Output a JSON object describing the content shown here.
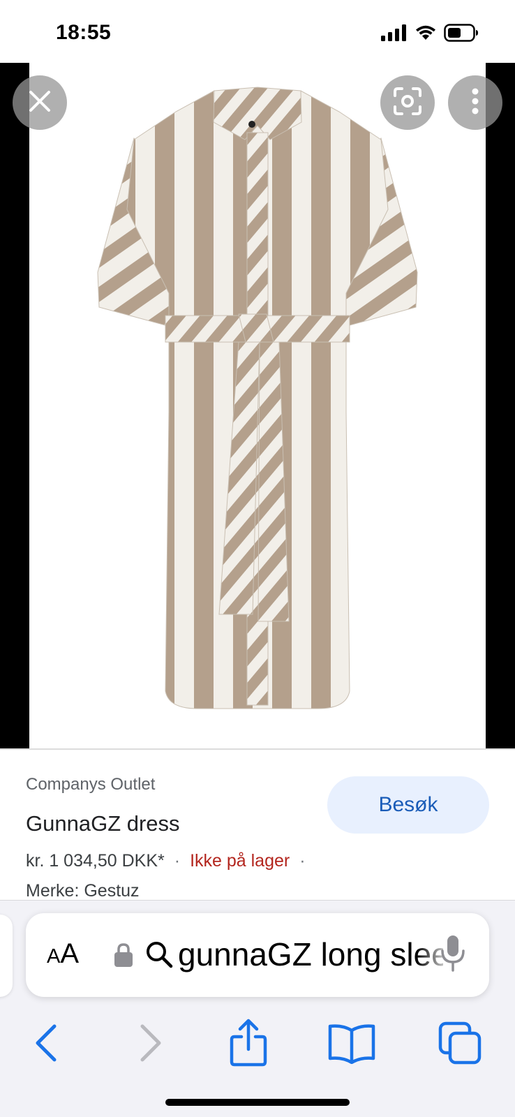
{
  "status_bar": {
    "time": "18:55",
    "icons": [
      "signal-icon",
      "wifi-icon",
      "battery-icon"
    ]
  },
  "image_viewer": {
    "image_description_icon": "striped-shirt-dress-image",
    "buttons": [
      "close-icon",
      "lens-icon",
      "more-icon"
    ]
  },
  "product": {
    "merchant": "Companys Outlet",
    "title": "GunnaGZ dress",
    "price": "kr. 1 034,50 DKK*",
    "separator": "·",
    "stock": "Ikke på lager",
    "brand": "Merke: Gestuz",
    "visit_label": "Besøk"
  },
  "address_bar": {
    "aa_large": "A",
    "aa_small": "A",
    "url": "gunnaGZ long sleeve dress"
  },
  "toolbar": {
    "icons": [
      "back-icon",
      "forward-icon",
      "share-icon",
      "bookmarks-icon",
      "tabs-icon"
    ]
  },
  "colors": {
    "accent": "#1a73e8",
    "stock_red": "#b3261e",
    "visit_bg": "#e8f0fe",
    "stripe": "#b4a08c"
  }
}
